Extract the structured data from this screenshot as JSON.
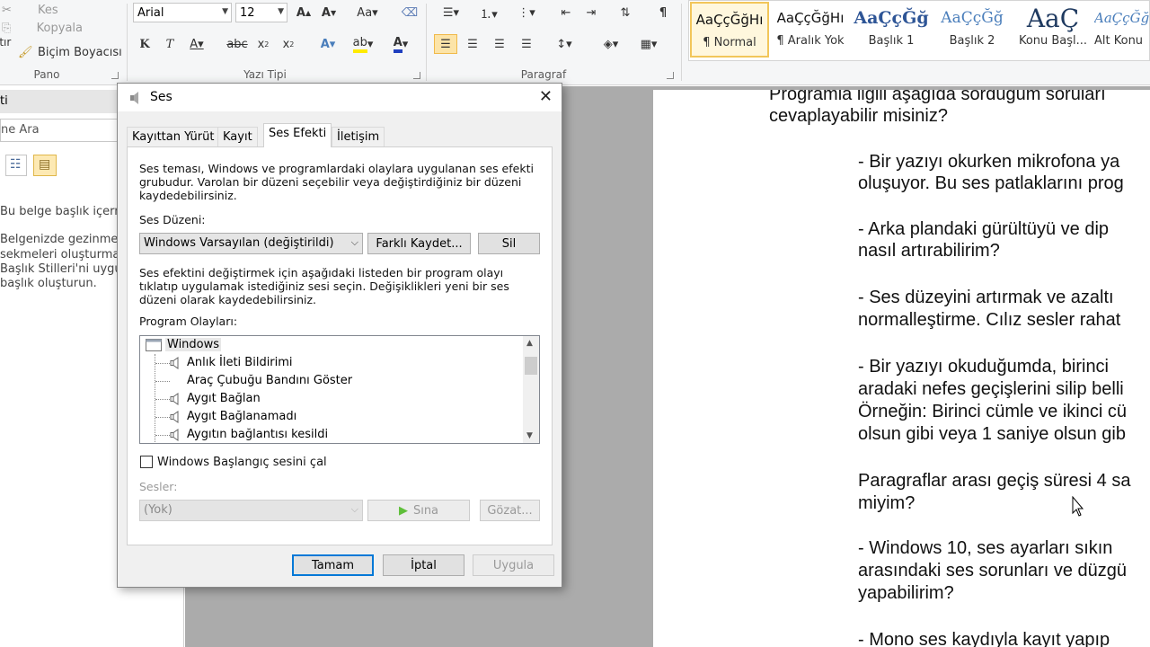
{
  "ribbon": {
    "clipboard": {
      "cut": "Kes",
      "copy": "Kopyala",
      "paste_partial": "ıtır",
      "format_painter": "Biçim Boyacısı",
      "group": "Pano"
    },
    "font": {
      "family": "Arial",
      "size": "12",
      "group": "Yazı Tipi"
    },
    "paragraph": {
      "group": "Paragraf"
    },
    "styles": [
      {
        "preview": "AaÇçĞğHı",
        "name": "¶ Normal"
      },
      {
        "preview": "AaÇçĞğHı",
        "name": "¶ Aralık Yok"
      },
      {
        "preview": "AaÇçĞğ",
        "name": "Başlık 1"
      },
      {
        "preview": "AaÇçĞğ",
        "name": "Başlık 2"
      },
      {
        "preview": "AaÇ",
        "name": "Konu Başl..."
      },
      {
        "preview": "AaÇçĞğ",
        "name": "Alt Konu"
      }
    ]
  },
  "navpane": {
    "title_partial": "ti",
    "search": "ne Ara",
    "lines": [
      "Bu belge başlık içerm",
      "Belgenizde gezinme",
      "sekmeleri oluşturmak",
      "Başlık Stilleri'ni uygu",
      "başlık oluşturun."
    ]
  },
  "document": {
    "lines": [
      "Programla ilgili aşağıda sorduğum soruları",
      "cevaplayabilir misiniz?",
      "-   Bir yazıyı okurken mikrofona ya",
      "oluşuyor. Bu ses patlaklarını prog",
      "-   Arka plandaki gürültüyü ve dip",
      "nasıl artırabilirim?",
      "-   Ses düzeyini artırmak ve azaltı",
      "normalleştirme. Cılız sesler rahat",
      "-   Bir yazıyı okuduğumda, birinci",
      "aradaki nefes geçişlerini silip belli",
      "Örneğin: Birinci cümle ve ikinci cü",
      "olsun gibi veya 1 saniye olsun gib",
      "Paragraflar arası geçiş süresi 4 sa",
      "miyim?",
      "-   Windows 10, ses ayarları sıkın",
      "arasındaki ses sorunları ve düzgü",
      "yapabilirim?",
      "-   Mono ses kaydıyla kayıt yapıp"
    ]
  },
  "dialog": {
    "title": "Ses",
    "tabs": [
      "Kayıttan Yürüt",
      "Kayıt",
      "Ses Efekti",
      "İletişim"
    ],
    "description": "Ses teması, Windows ve programlardaki olaylara uygulanan ses efekti grubudur. Varolan bir düzeni seçebilir veya değiştirdiğiniz bir düzeni kaydedebilirsiniz.",
    "scheme_label": "Ses Düzeni:",
    "scheme_value": "Windows Varsayılan (değiştirildi)",
    "save_as": "Farklı Kaydet...",
    "delete": "Sil",
    "instructions": "Ses efektini değiştirmek için aşağıdaki listeden bir program olayı tıklatıp uygulamak istediğiniz sesi seçin. Değişiklikleri yeni bir ses düzeni olarak kaydedebilirsiniz.",
    "events_label": "Program Olayları:",
    "events": {
      "root": "Windows",
      "items": [
        {
          "label": "Anlık İleti Bildirimi",
          "has_sound": true
        },
        {
          "label": "Araç Çubuğu Bandını Göster",
          "has_sound": false
        },
        {
          "label": "Aygıt Bağlan",
          "has_sound": true
        },
        {
          "label": "Aygıt Bağlanamadı",
          "has_sound": true
        },
        {
          "label": "Aygıtın bağlantısı kesildi",
          "has_sound": true
        }
      ]
    },
    "startup_checkbox": "Windows Başlangıç sesini çal",
    "sounds_label": "Sesler:",
    "sounds_value": "(Yok)",
    "test": "Sına",
    "browse": "Gözat...",
    "ok": "Tamam",
    "cancel": "İptal",
    "apply": "Uygula"
  }
}
